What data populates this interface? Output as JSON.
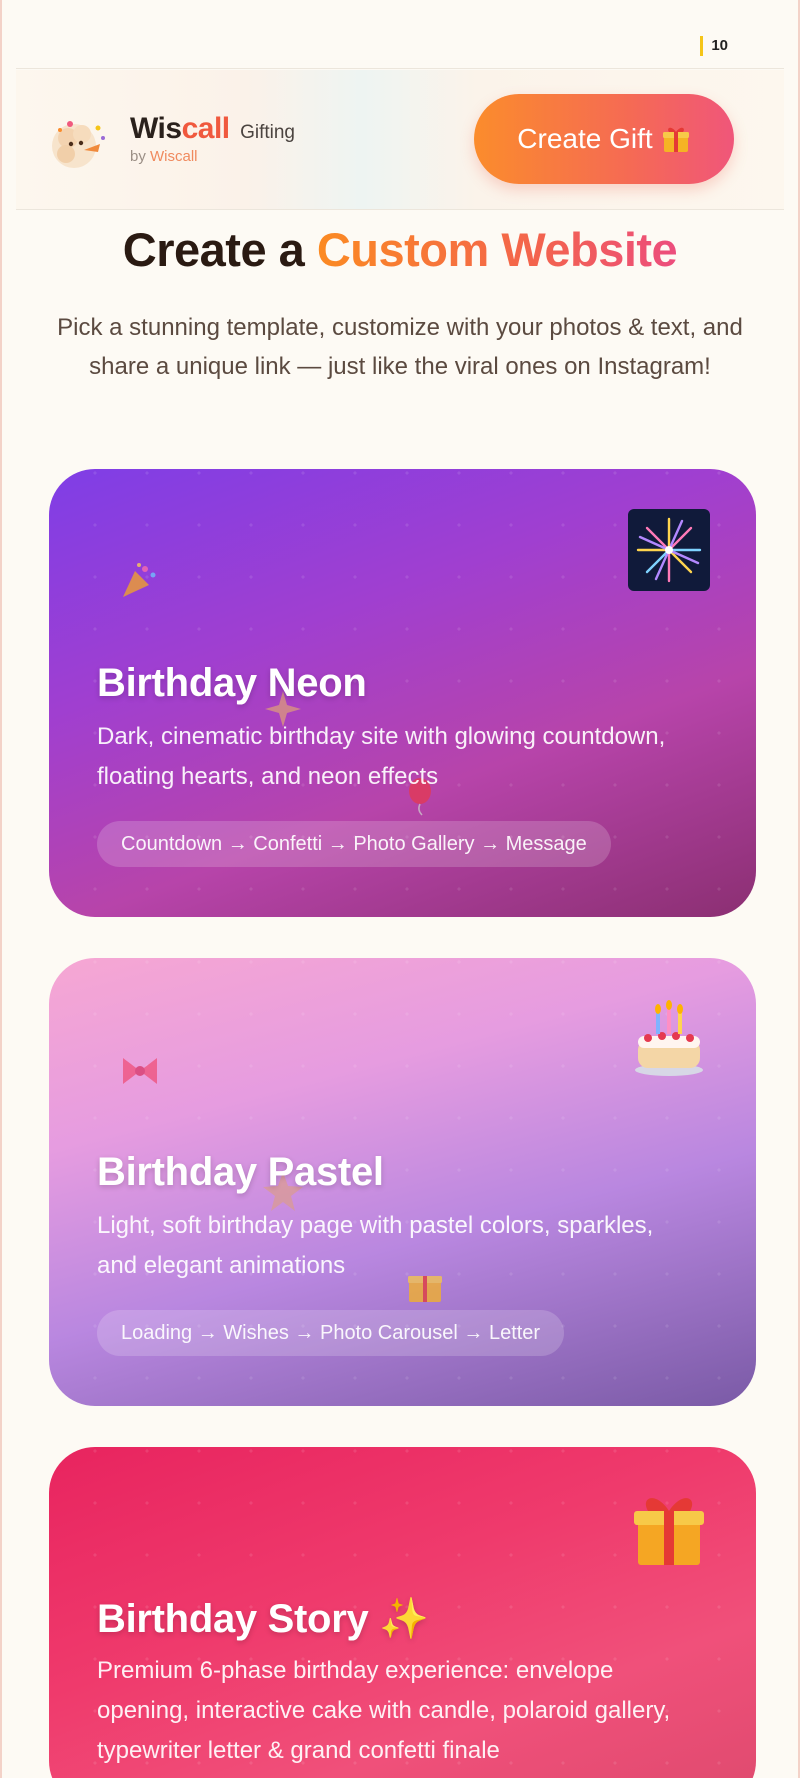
{
  "status_bar": {
    "count": "10"
  },
  "header": {
    "brand_main": "Wis",
    "brand_accent": "call",
    "brand_suffix": "Gifting",
    "by_prefix": "by",
    "by_name": "Wiscall",
    "create_button": "Create Gift",
    "create_icon": "gift-icon"
  },
  "hero": {
    "title_prefix": "Create a",
    "title_highlight": "Custom Website",
    "description": "Pick a stunning template, customize with your photos & text, and share a unique link — just like the viral ones on Instagram!"
  },
  "templates": [
    {
      "title": "Birthday Neon",
      "description": "Dark, cinematic birthday site with glowing countdown, floating hearts, and neon effects",
      "flow": "Countdown → Confetti → Photo Gallery → Message",
      "icon": "fireworks-icon"
    },
    {
      "title": "Birthday Pastel",
      "description": "Light, soft birthday page with pastel colors, sparkles, and elegant animations",
      "flow": "Loading → Wishes → Photo Carousel → Letter",
      "icon": "cake-icon"
    },
    {
      "title": "Birthday Story ✨",
      "description": "Premium 6-phase birthday experience: envelope opening, interactive cake with candle, polaroid gallery, typewriter letter & grand confetti finale",
      "icon": "gift-box-icon"
    }
  ],
  "colors": {
    "accent_orange": "#fb8c2c",
    "accent_pink": "#f0567a",
    "neon_purple": "#7f3ee6",
    "pastel_pink": "#f6a7d3",
    "story_red": "#e8245f"
  }
}
